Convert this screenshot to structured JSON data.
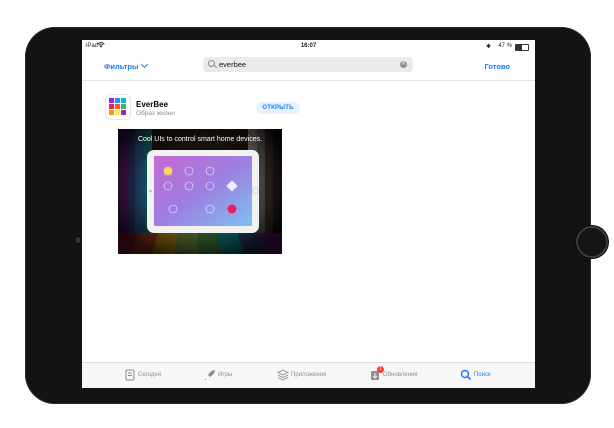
{
  "status_bar": {
    "device": "iPad",
    "time": "16:07",
    "battery": "47 %",
    "battery_level": 0.47
  },
  "nav": {
    "filters_label": "Фильтры",
    "search_value": "everbee",
    "done_label": "Готово"
  },
  "result": {
    "app_name": "EverBee",
    "category": "Образ жизни",
    "open_label": "ОТКРЫТЬ",
    "screenshot_caption": "Cool UIs to control smart home devices."
  },
  "tabs": [
    {
      "label": "Сегодня",
      "icon": "today-icon"
    },
    {
      "label": "Игры",
      "icon": "rocket-icon"
    },
    {
      "label": "Приложения",
      "icon": "layers-icon"
    },
    {
      "label": "Обновления",
      "icon": "updates-icon",
      "badge": "1"
    },
    {
      "label": "Поиск",
      "icon": "search-icon",
      "active": true
    }
  ],
  "colors": {
    "accent": "#1a7cf5",
    "device_frame": "#131313",
    "badge": "#ff3b30"
  }
}
